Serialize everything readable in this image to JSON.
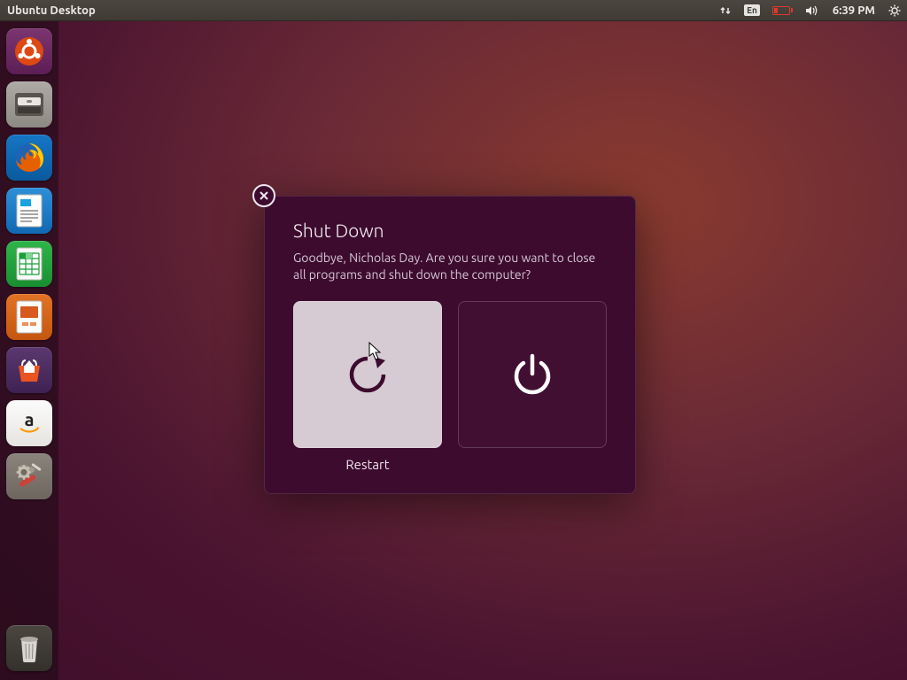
{
  "menubar": {
    "title": "Ubuntu Desktop",
    "language_indicator": "En",
    "clock": "6:39 PM"
  },
  "launcher": {
    "items": [
      {
        "name": "dash",
        "label": "Dash"
      },
      {
        "name": "files",
        "label": "Files"
      },
      {
        "name": "firefox",
        "label": "Firefox"
      },
      {
        "name": "writer",
        "label": "LibreOffice Writer"
      },
      {
        "name": "calc",
        "label": "LibreOffice Calc"
      },
      {
        "name": "impress",
        "label": "LibreOffice Impress"
      },
      {
        "name": "software",
        "label": "Ubuntu Software"
      },
      {
        "name": "amazon",
        "label": "Amazon"
      },
      {
        "name": "settings",
        "label": "System Settings"
      }
    ],
    "trash_label": "Trash"
  },
  "dialog": {
    "title": "Shut Down",
    "message": "Goodbye, Nicholas Day. Are you sure you want to close all programs and shut down the computer?",
    "restart_label": "Restart",
    "close_aria": "Close"
  }
}
